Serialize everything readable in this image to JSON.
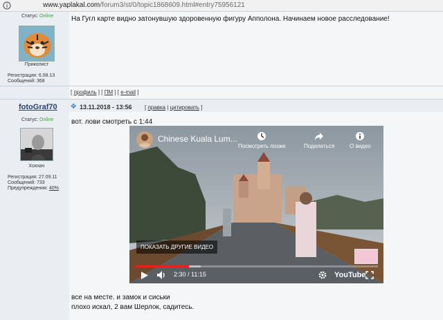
{
  "browser": {
    "url_host": "www.yaplakal.com",
    "url_path": "/forum3/st/0/topic1868609.html#entry75956121"
  },
  "post1": {
    "status_label": "Статус:",
    "status_value": "Online",
    "user_title": "Приколист",
    "reg_label": "Регистрация:",
    "reg_value": "6.08.13",
    "msgs_label": "Сообщений:",
    "msgs_value": "368",
    "text": "На Гугл карте видно затонувшую здоровенную фигуру Апполона. Начинаем новое расследование!",
    "links": {
      "profile": "профиль",
      "pm": "ПМ",
      "email": "e-mail"
    }
  },
  "post2": {
    "username": "fotoGraf70",
    "date": "13.11.2018 - 13:56",
    "actions": {
      "edit": "правка",
      "quote": "цитировать"
    },
    "status_label": "Статус:",
    "status_value": "Online",
    "user_title": "Хохнач",
    "reg_label": "Регистрация:",
    "reg_value": "27.09.11",
    "msgs_label": "Сообщений:",
    "msgs_value": "733",
    "warn_label": "Предупреждения:",
    "warn_value": "40%",
    "intro_text": "вот. лови смотреть с 1:44",
    "after_text_1": "все на месте. и замок и сиськи",
    "after_text_2": "плохо искал, 2 вам Шерлок, садитесь."
  },
  "video": {
    "title": "Chinese Kuala Lum...",
    "watch_later": "Посмотреть позже",
    "share": "Поделиться",
    "info": "О видео",
    "more_videos": "ПОКАЗАТЬ ДРУГИЕ ВИДЕО",
    "time": "2:30 / 11:15",
    "played_fraction": 0.222,
    "loaded_fraction": 0.27,
    "logo": "YouTube"
  }
}
